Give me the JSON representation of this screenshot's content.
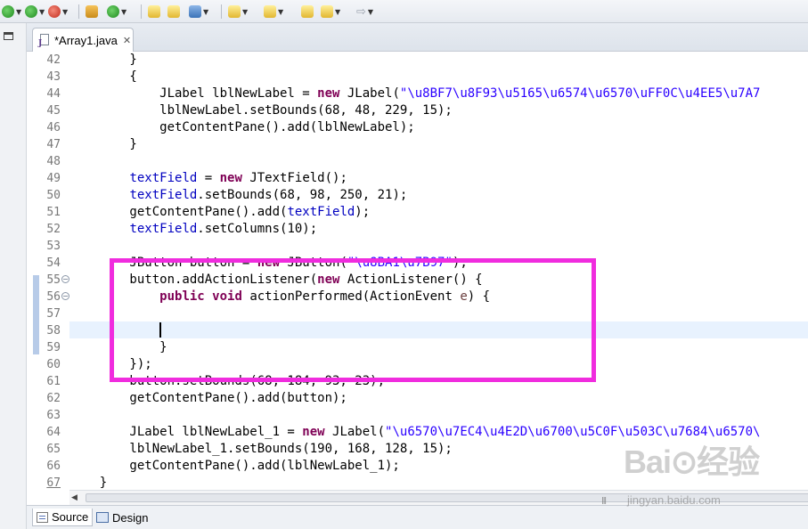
{
  "editor": {
    "tab_label": "*Array1.java",
    "close_glyph": "✕",
    "lines": [
      {
        "n": "42",
        "segs": [
          [
            "",
            "        }"
          ]
        ]
      },
      {
        "n": "43",
        "segs": [
          [
            "",
            "        {"
          ]
        ]
      },
      {
        "n": "44",
        "segs": [
          [
            "",
            "            JLabel lblNewLabel = "
          ],
          [
            "kw",
            "new"
          ],
          [
            "",
            " JLabel("
          ],
          [
            "str",
            "\"\\u8BF7\\u8F93\\u5165\\u6574\\u6570\\uFF0C\\u4EE5\\u7A7"
          ]
        ]
      },
      {
        "n": "45",
        "segs": [
          [
            "",
            "            lblNewLabel.setBounds(68, 48, 229, 15);"
          ]
        ]
      },
      {
        "n": "46",
        "segs": [
          [
            "",
            "            getContentPane().add(lblNewLabel);"
          ]
        ]
      },
      {
        "n": "47",
        "segs": [
          [
            "",
            "        }"
          ]
        ]
      },
      {
        "n": "48",
        "segs": [
          [
            "",
            ""
          ]
        ]
      },
      {
        "n": "49",
        "segs": [
          [
            "",
            "        "
          ],
          [
            "fld",
            "textField"
          ],
          [
            "",
            " = "
          ],
          [
            "kw",
            "new"
          ],
          [
            "",
            " JTextField();"
          ]
        ]
      },
      {
        "n": "50",
        "segs": [
          [
            "",
            "        "
          ],
          [
            "fld",
            "textField"
          ],
          [
            "",
            ".setBounds(68, 98, 250, 21);"
          ]
        ]
      },
      {
        "n": "51",
        "segs": [
          [
            "",
            "        getContentPane().add("
          ],
          [
            "fld",
            "textField"
          ],
          [
            "",
            ");"
          ]
        ]
      },
      {
        "n": "52",
        "segs": [
          [
            "",
            "        "
          ],
          [
            "fld",
            "textField"
          ],
          [
            "",
            ".setColumns(10);"
          ]
        ]
      },
      {
        "n": "53",
        "segs": [
          [
            "",
            ""
          ]
        ]
      },
      {
        "n": "54",
        "segs": [
          [
            "",
            "        JButton button = "
          ],
          [
            "kw",
            "new"
          ],
          [
            "",
            " JButton("
          ],
          [
            "str",
            "\"\\u8BA1\\u7B97\""
          ],
          [
            "",
            ");"
          ]
        ]
      },
      {
        "n": "55",
        "segs": [
          [
            "",
            "        button.addActionListener("
          ],
          [
            "kw",
            "new"
          ],
          [
            "",
            " ActionListener() {"
          ]
        ]
      },
      {
        "n": "56",
        "segs": [
          [
            "",
            "            "
          ],
          [
            "kw",
            "public"
          ],
          [
            "",
            " "
          ],
          [
            "kw",
            "void"
          ],
          [
            "",
            " actionPerformed(ActionEvent "
          ],
          [
            "par",
            "e"
          ],
          [
            "",
            ") {"
          ]
        ]
      },
      {
        "n": "57",
        "segs": [
          [
            "",
            ""
          ]
        ]
      },
      {
        "n": "58",
        "segs": [
          [
            "",
            ""
          ]
        ]
      },
      {
        "n": "59",
        "segs": [
          [
            "",
            "            }"
          ]
        ]
      },
      {
        "n": "60",
        "segs": [
          [
            "",
            "        });"
          ]
        ]
      },
      {
        "n": "61",
        "segs": [
          [
            "",
            "        button.setBounds(68, 184, 93, 23);"
          ]
        ]
      },
      {
        "n": "62",
        "segs": [
          [
            "",
            "        getContentPane().add(button);"
          ]
        ]
      },
      {
        "n": "63",
        "segs": [
          [
            "",
            ""
          ]
        ]
      },
      {
        "n": "64",
        "segs": [
          [
            "",
            "        JLabel lblNewLabel_1 = "
          ],
          [
            "kw",
            "new"
          ],
          [
            "",
            " JLabel("
          ],
          [
            "str",
            "\"\\u6570\\u7EC4\\u4E2D\\u6700\\u5C0F\\u503C\\u7684\\u6570\\"
          ]
        ]
      },
      {
        "n": "65",
        "segs": [
          [
            "",
            "        lblNewLabel_1.setBounds(190, 168, 128, 15);"
          ]
        ]
      },
      {
        "n": "66",
        "segs": [
          [
            "",
            "        getContentPane().add(lblNewLabel_1);"
          ]
        ]
      },
      {
        "n": "67",
        "segs": [
          [
            "",
            "    }"
          ]
        ]
      }
    ]
  },
  "bottom_tabs": {
    "source": "Source",
    "design": "Design"
  },
  "watermark": {
    "logo": "Bai⊙经验",
    "url": "jingyan.baidu.com"
  },
  "colors": {
    "highlight_box": "#f02cde",
    "keyword": "#7f0055",
    "field": "#0000c0",
    "string": "#2a00ff"
  }
}
